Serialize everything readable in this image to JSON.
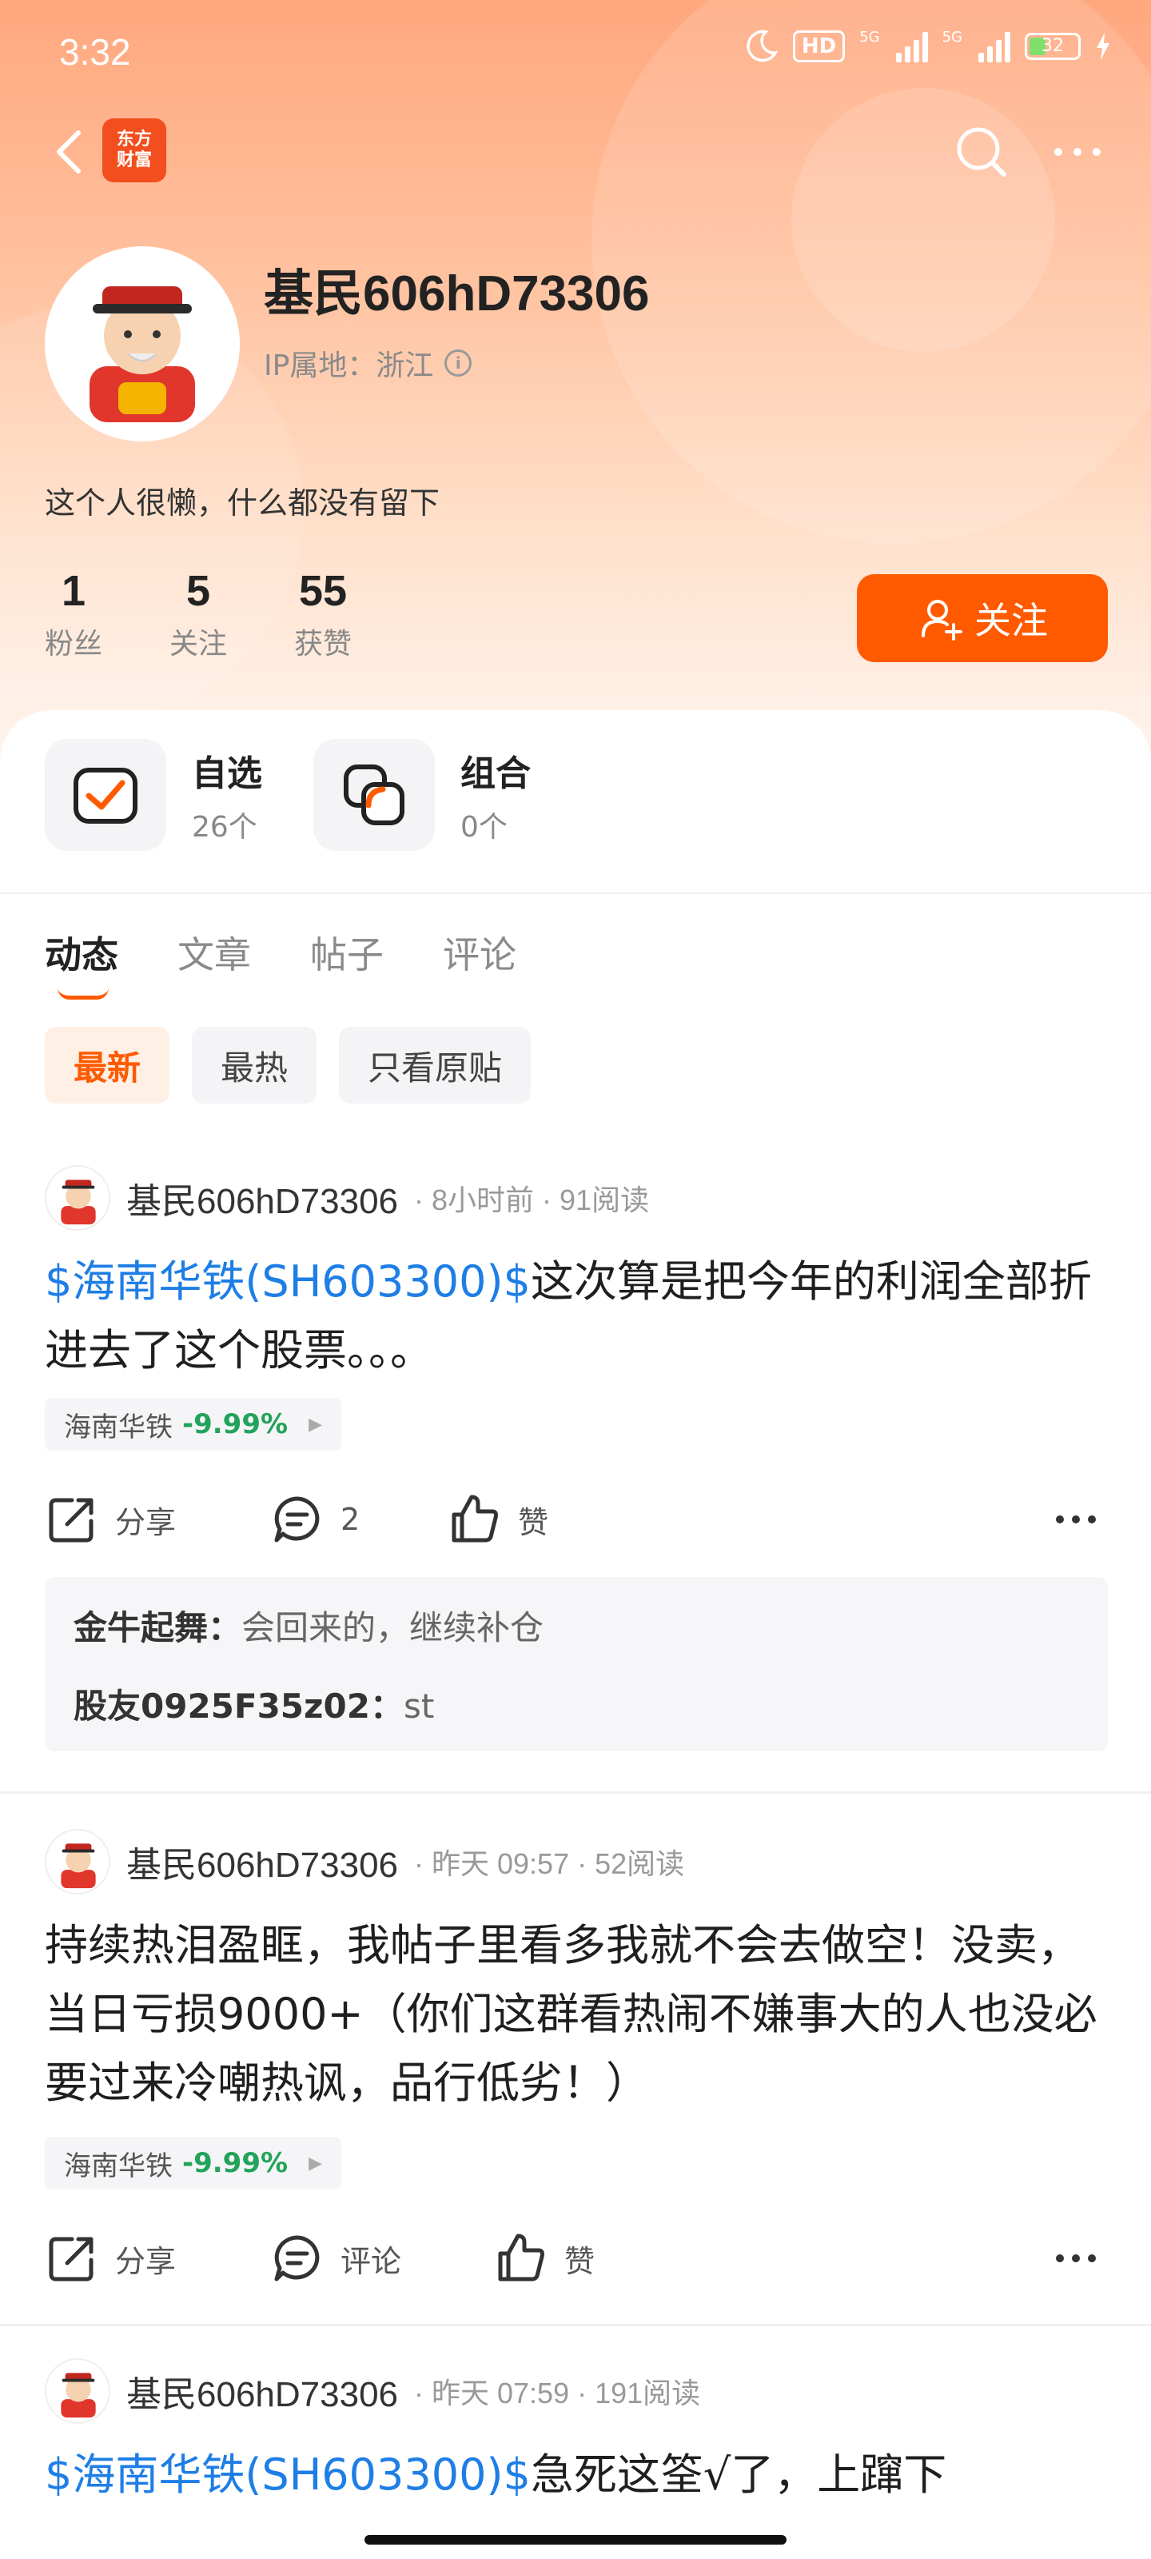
{
  "status_bar": {
    "time": "3:32",
    "hd": "HD",
    "net1": "5G",
    "net2": "5G",
    "battery": "32"
  },
  "app": {
    "logo_line1": "东方",
    "logo_line2": "财富"
  },
  "profile": {
    "username": "基民606hD73306",
    "ip_label": "IP属地：浙江",
    "bio": "这个人很懒，什么都没有留下",
    "stats": [
      {
        "value": "1",
        "label": "粉丝"
      },
      {
        "value": "5",
        "label": "关注"
      },
      {
        "value": "55",
        "label": "获赞"
      }
    ],
    "follow_label": "关注"
  },
  "quick_links": [
    {
      "title": "自选",
      "sub": "26个"
    },
    {
      "title": "组合",
      "sub": "0个"
    }
  ],
  "tabs": [
    "动态",
    "文章",
    "帖子",
    "评论"
  ],
  "filters": [
    "最新",
    "最热",
    "只看原贴"
  ],
  "colors": {
    "accent": "#ff5a00",
    "link": "#1e7ee6",
    "down": "#22a35a"
  },
  "posts": [
    {
      "author": "基民606hD73306",
      "meta": "· 8小时前 · 91阅读",
      "ticker": "$海南华铁(SH603300)$",
      "text": "这次算是把今年的利润全部折进去了这个股票。。。",
      "stock": {
        "name": "海南华铁",
        "change": "-9.99%"
      },
      "share": "分享",
      "comment": "2",
      "like": "赞",
      "comments": [
        {
          "user": "金牛起舞：",
          "text": "会回来的，继续补仓"
        },
        {
          "user": "股友0925F35z02：",
          "text": "st"
        }
      ]
    },
    {
      "author": "基民606hD73306",
      "meta": "· 昨天 09:57 · 52阅读",
      "text": "持续热泪盈眶，我帖子里看多我就不会去做空！没卖，当日亏损9000+（你们这群看热闹不嫌事大的人也没必要过来冷嘲热讽，品行低劣！）",
      "stock": {
        "name": "海南华铁",
        "change": "-9.99%"
      },
      "share": "分享",
      "comment": "评论",
      "like": "赞"
    },
    {
      "author": "基民606hD73306",
      "meta": "· 昨天 07:59 · 191阅读",
      "ticker": "$海南华铁(SH603300)$",
      "text": "急死这筌√了，上蹿下"
    }
  ]
}
